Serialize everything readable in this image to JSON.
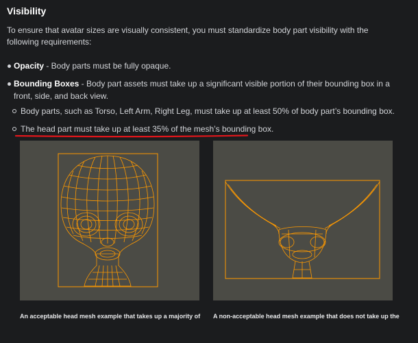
{
  "section": {
    "heading": "Visibility",
    "intro": "To ensure that avatar sizes are visually consistent, you must standardize body part visibility with the following requirements:"
  },
  "bullets": {
    "opacity": {
      "title": "Opacity",
      "text": " - Body parts must be fully opaque."
    },
    "bounding": {
      "title": "Bounding Boxes",
      "text": " - Body part assets must take up a significant visible portion of their bounding box in a front, side, and back view."
    },
    "sub1": "Body parts, such as Torso, Left Arm, Right Leg, must take up at least 50% of body part’s bounding box.",
    "sub2": "The head part must take up at least 35% of the mesh’s bounding box."
  },
  "figures": {
    "left_caption": "An acceptable head mesh example that takes up a majority of",
    "right_caption": "A non-acceptable head mesh example that does not take up the"
  },
  "colors": {
    "background": "#1b1c1e",
    "panel": "#4b4b45",
    "wireframe": "#ff9a00",
    "underline": "#e0161b"
  }
}
